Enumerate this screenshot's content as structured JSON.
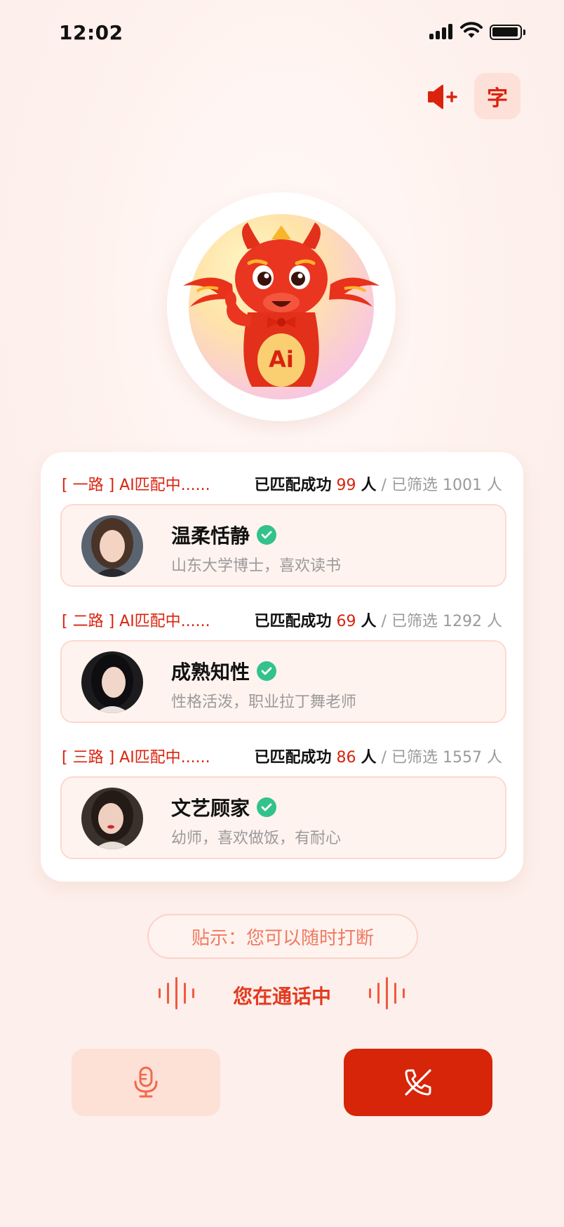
{
  "status_bar": {
    "time": "12:02"
  },
  "controls": {
    "caption_label": "字",
    "volume_icon": "volume-plus-icon"
  },
  "mascot": {
    "text": "Ai"
  },
  "lines": [
    {
      "tag": "[ 一路 ] AI匹配中......",
      "matched_label": "已匹配成功",
      "matched_count": "99",
      "unit": "人",
      "sep": "/",
      "screened_label": "已筛选",
      "screened_count": "1001",
      "screened_unit": "人",
      "name": "温柔恬静",
      "desc": "山东大学博士，喜欢读书"
    },
    {
      "tag": "[ 二路 ] AI匹配中......",
      "matched_label": "已匹配成功",
      "matched_count": "69",
      "unit": "人",
      "sep": "/",
      "screened_label": "已筛选",
      "screened_count": "1292",
      "screened_unit": "人",
      "name": "成熟知性",
      "desc": "性格活泼，职业拉丁舞老师"
    },
    {
      "tag": "[ 三路 ] AI匹配中......",
      "matched_label": "已匹配成功",
      "matched_count": "86",
      "unit": "人",
      "sep": "/",
      "screened_label": "已筛选",
      "screened_count": "1557",
      "screened_unit": "人",
      "name": "文艺顾家",
      "desc": "幼师，喜欢做饭，有耐心"
    }
  ],
  "tip": "贴示：您可以随时打断",
  "calling": "您在通话中",
  "colors": {
    "accent": "#d9230f",
    "verified": "#32c28a",
    "hangup": "#d62508",
    "mic_bg": "#fde0d6"
  }
}
